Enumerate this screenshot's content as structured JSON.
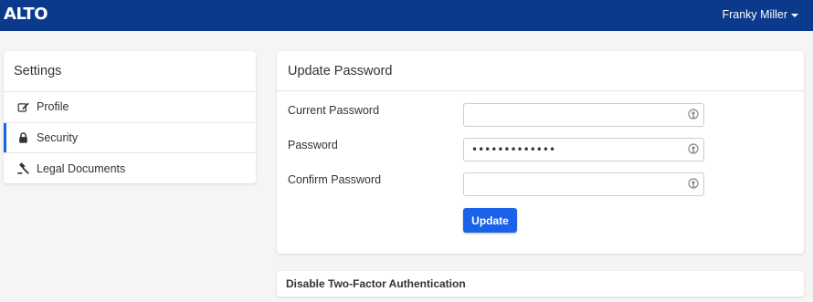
{
  "app": {
    "logo_text": "ALTO"
  },
  "header": {
    "user_name": "Franky Miller",
    "accent_color": "#0b3a8c"
  },
  "settings": {
    "title": "Settings",
    "items": [
      {
        "label": "Profile",
        "icon": "edit-icon"
      },
      {
        "label": "Security",
        "icon": "lock-icon",
        "active": true
      },
      {
        "label": "Legal Documents",
        "icon": "gavel-icon"
      }
    ]
  },
  "update_password": {
    "title": "Update Password",
    "fields": [
      {
        "label": "Current Password",
        "value": ""
      },
      {
        "label": "Password",
        "value": "•••••••••••••"
      },
      {
        "label": "Confirm Password",
        "value": ""
      }
    ],
    "button_label": "Update",
    "button_color": "#1a62e8"
  },
  "two_factor": {
    "title": "Disable Two-Factor Authentication"
  }
}
